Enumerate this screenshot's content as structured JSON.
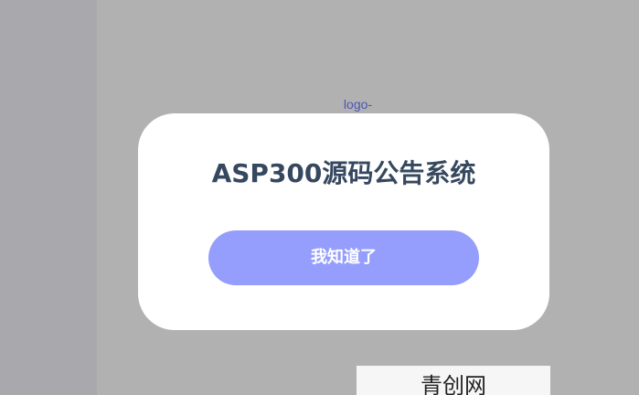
{
  "page": {
    "logo_text": "logo-"
  },
  "dialog": {
    "title": "ASP300源码公告系统",
    "confirm_label": "我知道了"
  },
  "brand": {
    "text": "青创网"
  },
  "colors": {
    "overlay": "#b1b1b1",
    "dialog_bg": "#ffffff",
    "title": "#36485f",
    "button_bg": "#959efc",
    "button_text": "#ffffff",
    "logo_text": "#4b55b5"
  }
}
